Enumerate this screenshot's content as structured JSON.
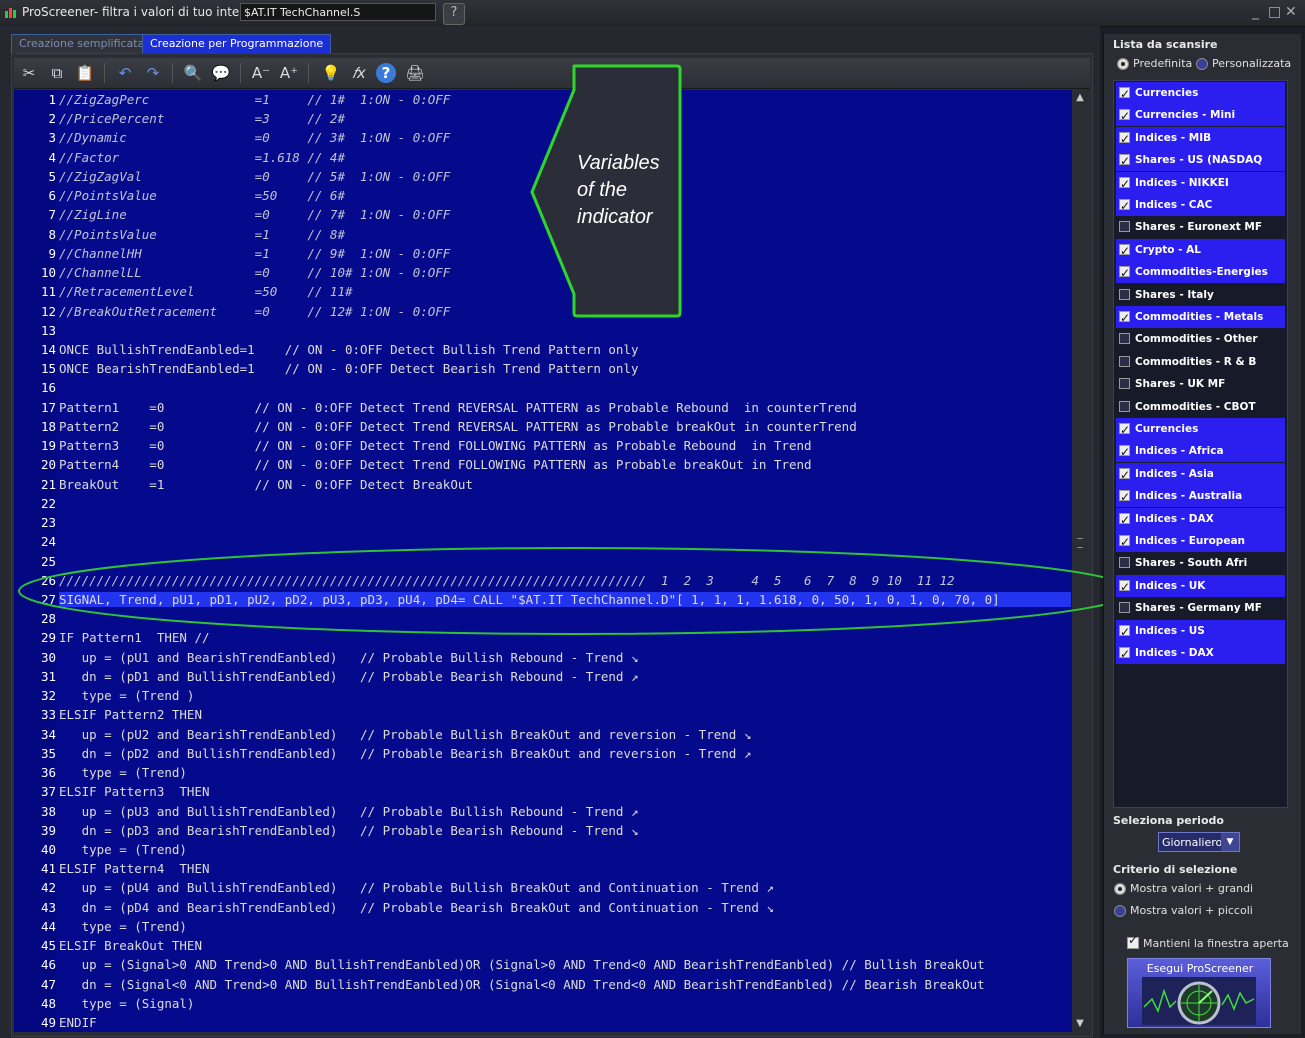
{
  "window": {
    "title": "ProScreener- filtra i valori di tuo interesse",
    "screener_name": "$AT.IT TechChannel.S",
    "controls": [
      "_",
      "□",
      "✕"
    ]
  },
  "tabs": [
    {
      "label": "Creazione semplificata",
      "active": false
    },
    {
      "label": "Creazione per Programmazione",
      "active": true
    }
  ],
  "toolbar": {
    "icons": [
      "cut-icon",
      "copy-icon",
      "paste-icon",
      "undo-icon",
      "redo-icon",
      "search-icon",
      "comment-icon",
      "decrease-font-icon",
      "increase-font-icon",
      "lightbulb-icon",
      "function-icon",
      "help-icon",
      "print-icon"
    ],
    "glyphs": [
      "✂",
      "⧉",
      "📋",
      "↶",
      "↷",
      "🔍",
      "💬",
      "A⁻",
      "A⁺",
      "💡",
      "𝑓x",
      "?",
      "🖨"
    ]
  },
  "code": {
    "lines": [
      "//ZigZagPerc              =1     // 1#  1:ON - 0:OFF",
      "//PricePercent            =3     // 2#",
      "//Dynamic                 =0     // 3#  1:ON - 0:OFF",
      "//Factor                  =1.618 // 4#",
      "//ZigZagVal               =0     // 5#  1:ON - 0:OFF",
      "//PointsValue             =50    // 6#",
      "//ZigLine                 =0     // 7#  1:ON - 0:OFF",
      "//PointsValue             =1     // 8#",
      "//ChannelHH               =1     // 9#  1:ON - 0:OFF",
      "//ChannelLL               =0     // 10# 1:ON - 0:OFF",
      "//RetracementLevel        =50    // 11#",
      "//BreakOutRetracement     =0     // 12# 1:ON - 0:OFF",
      "",
      "ONCE BullishTrendEanbled=1    // ON - 0:OFF Detect Bullish Trend Pattern only",
      "ONCE BearishTrendEanbled=1    // ON - 0:OFF Detect Bearish Trend Pattern only",
      "",
      "Pattern1    =0            // ON - 0:OFF Detect Trend REVERSAL PATTERN as Probable Rebound  in counterTrend",
      "Pattern2    =0            // ON - 0:OFF Detect Trend REVERSAL PATTERN as Probable breakOut in counterTrend",
      "Pattern3    =0            // ON - 0:OFF Detect Trend FOLLOWING PATTERN as Probable Rebound  in Trend",
      "Pattern4    =0            // ON - 0:OFF Detect Trend FOLLOWING PATTERN as Probable breakOut in Trend",
      "BreakOut    =1            // ON - 0:OFF Detect BreakOut",
      "",
      "",
      "",
      "",
      "//////////////////////////////////////////////////////////////////////////////  1  2  3     4  5   6  7  8  9 10  11 12",
      "SIGNAL, Trend, pU1, pD1, pU2, pD2, pU3, pD3, pU4, pD4= CALL \"$AT.IT TechChannel.D\"[ 1, 1, 1, 1.618, 0, 50, 1, 0, 1, 0, 70, 0]",
      "",
      "IF Pattern1  THEN //",
      "   up = (pU1 and BearishTrendEanbled)   // Probable Bullish Rebound - Trend ↘",
      "   dn = (pD1 and BullishTrendEanbled)   // Probable Bearish Rebound - Trend ↗",
      "   type = (Trend )",
      "ELSIF Pattern2 THEN",
      "   up = (pU2 and BearishTrendEanbled)   // Probable Bullish BreakOut and reversion - Trend ↘",
      "   dn = (pD2 and BullishTrendEanbled)   // Probable Bearish BreakOut and reversion - Trend ↗",
      "   type = (Trend)",
      "ELSIF Pattern3  THEN",
      "   up = (pU3 and BullishTrendEanbled)   // Probable Bullish Rebound - Trend ↗",
      "   dn = (pD3 and BearishTrendEanbled)   // Probable Bearish Rebound - Trend ↘",
      "   type = (Trend)",
      "ELSIF Pattern4  THEN",
      "   up = (pU4 and BullishTrendEanbled)   // Probable Bullish BreakOut and Continuation - Trend ↗",
      "   dn = (pD4 and BearishTrendEanbled)   // Probable Bearish BreakOut and Continuation - Trend ↘",
      "   type = (Trend)",
      "ELSIF BreakOut THEN",
      "   up = (Signal>0 AND Trend>0 AND BullishTrendEanbled)OR (Signal>0 AND Trend<0 AND BearishTrendEanbled) // Bullish BreakOut",
      "   dn = (Signal<0 AND Trend>0 AND BullishTrendEanbled)OR (Signal<0 AND Trend<0 AND BearishTrendEanbled) // Bearish BreakOut",
      "   type = (Signal)",
      "ENDIF"
    ],
    "highlighted_line": 27
  },
  "callout": {
    "text_lines": [
      "Variables",
      "of  the",
      "indicator"
    ],
    "border_color": "#22d42a"
  },
  "right_panel": {
    "list_title": "Lista da scansire",
    "radio_default": "Predefinita",
    "radio_custom": "Personalizzata",
    "items": [
      {
        "label": "Currencies",
        "checked": true
      },
      {
        "label": "Currencies - Mini",
        "checked": true
      },
      {
        "label": "Indices - MIB",
        "checked": true
      },
      {
        "label": "Shares - US (NASDAQ",
        "checked": true
      },
      {
        "label": "Indices - NIKKEI",
        "checked": true
      },
      {
        "label": "Indices - CAC",
        "checked": true
      },
      {
        "label": "Shares - Euronext MF",
        "checked": false
      },
      {
        "label": "Crypto - AL",
        "checked": true
      },
      {
        "label": "Commodities-Energies",
        "checked": true
      },
      {
        "label": "Shares - Italy",
        "checked": false
      },
      {
        "label": "Commodities - Metals",
        "checked": true
      },
      {
        "label": "Commodities - Other",
        "checked": false
      },
      {
        "label": "Commodities - R & B",
        "checked": false
      },
      {
        "label": "Shares - UK MF",
        "checked": false
      },
      {
        "label": "Commodities - CBOT",
        "checked": false
      },
      {
        "label": "Currencies",
        "checked": true
      },
      {
        "label": "Indices - Africa",
        "checked": true
      },
      {
        "label": "Indices - Asia",
        "checked": true
      },
      {
        "label": "Indices - Australia",
        "checked": true
      },
      {
        "label": "Indices - DAX",
        "checked": true
      },
      {
        "label": "Indices - European",
        "checked": true
      },
      {
        "label": "Shares - South Afri",
        "checked": false
      },
      {
        "label": "Indices - UK",
        "checked": true
      },
      {
        "label": "Shares - Germany MF",
        "checked": false
      },
      {
        "label": "Indices - US",
        "checked": true
      },
      {
        "label": "Indices - DAX",
        "checked": true
      }
    ],
    "period_label": "Seleziona periodo",
    "period_value": "Giornaliero",
    "criteria_label": "Criterio di selezione",
    "criteria_high": "Mostra valori + grandi",
    "criteria_low": "Mostra valori + piccoli",
    "keep_open": "Mantieni la finestra aperta",
    "run_button": "Esegui ProScreener"
  }
}
